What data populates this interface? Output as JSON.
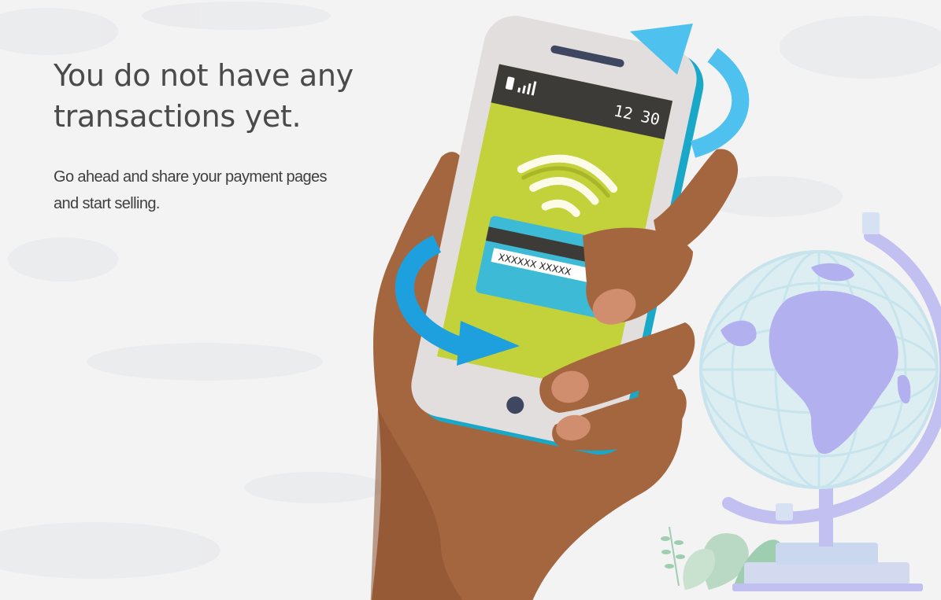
{
  "empty_state": {
    "headline_line1": "You do not have any",
    "headline_line2": "transactions yet.",
    "subtext_line1": "Go ahead and share your payment pages",
    "subtext_line2": "and start selling."
  },
  "illustration": {
    "phone_time_hours": "12",
    "phone_time_minutes": "30",
    "card_number": "XXXXXX XXXXX"
  },
  "colors": {
    "background": "#f3f3f4",
    "headline": "#4a4a4a",
    "phone_screen": "#c3d13b",
    "arrow": "#29a8e0",
    "skin": "#a4663f",
    "globe": "#b9b5ef"
  }
}
